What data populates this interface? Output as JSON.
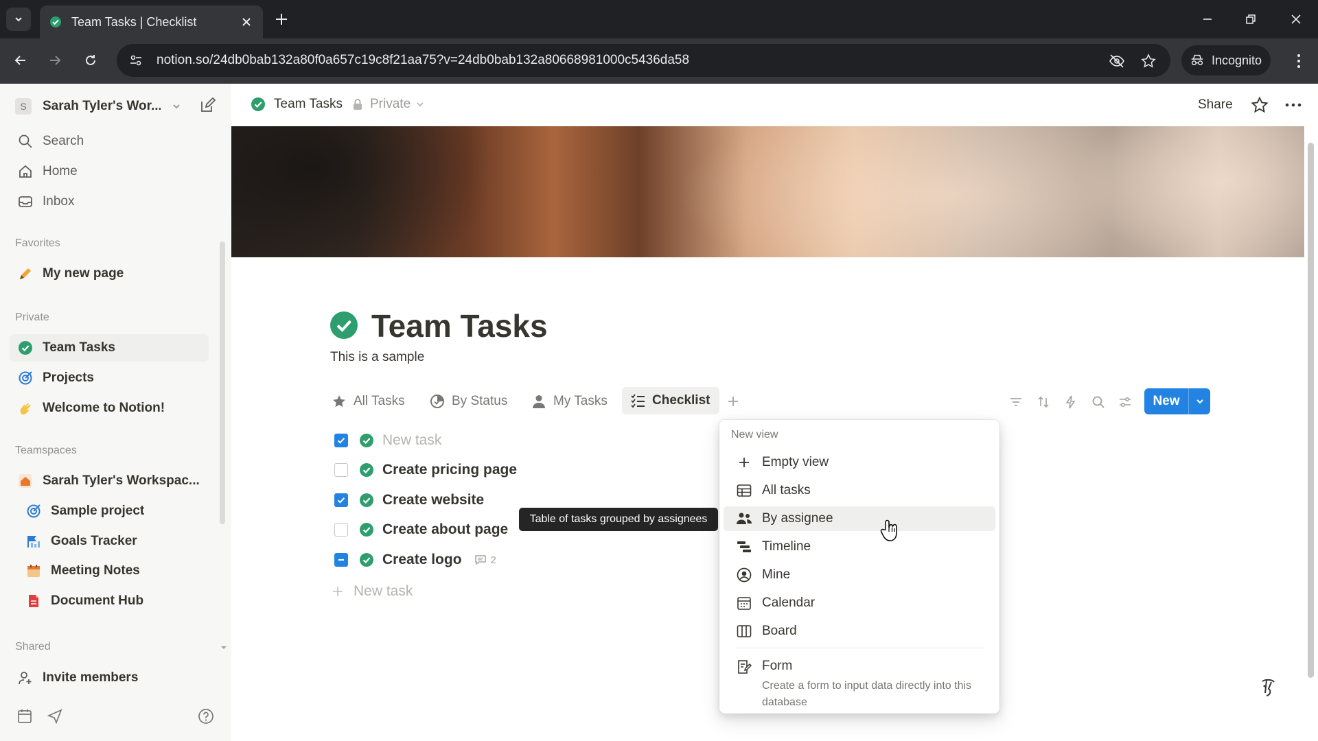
{
  "browser": {
    "tab_title": "Team Tasks | Checklist",
    "url": "notion.so/24db0bab132a80f0a657c19c8f21aa75?v=24db0bab132a80668981000c5436da58",
    "incognito_label": "Incognito"
  },
  "sidebar": {
    "workspace_initial": "S",
    "workspace_name": "Sarah Tyler's Wor...",
    "top_items": [
      {
        "label": "Search",
        "icon": "search-icon"
      },
      {
        "label": "Home",
        "icon": "home-icon"
      },
      {
        "label": "Inbox",
        "icon": "inbox-icon"
      }
    ],
    "favorites_label": "Favorites",
    "favorites": [
      {
        "label": "My new page",
        "icon": "pencil-icon"
      }
    ],
    "private_label": "Private",
    "private_items": [
      {
        "label": "Team Tasks",
        "icon": "check-circle-icon"
      },
      {
        "label": "Projects",
        "icon": "target-icon"
      },
      {
        "label": "Welcome to Notion!",
        "icon": "wave-icon"
      }
    ],
    "teamspaces_label": "Teamspaces",
    "teamspace_name": "Sarah Tyler's Workspac...",
    "teamspace_items": [
      {
        "label": "Sample project",
        "icon": "target-icon"
      },
      {
        "label": "Goals Tracker",
        "icon": "goals-icon"
      },
      {
        "label": "Meeting Notes",
        "icon": "calendar-icon"
      },
      {
        "label": "Document Hub",
        "icon": "document-icon"
      }
    ],
    "shared_label": "Shared",
    "invite_label": "Invite members"
  },
  "topbar": {
    "breadcrumb": "Team Tasks",
    "privacy": "Private",
    "share_label": "Share"
  },
  "page": {
    "title": "Team Tasks",
    "description": "This is a sample",
    "views": [
      {
        "label": "All Tasks",
        "icon": "star-icon"
      },
      {
        "label": "By Status",
        "icon": "status-icon"
      },
      {
        "label": "My Tasks",
        "icon": "person-icon"
      },
      {
        "label": "Checklist",
        "icon": "checklist-icon",
        "active": true
      }
    ],
    "new_button": "New",
    "tasks": [
      {
        "name": "New task",
        "checked": true,
        "placeholder": true
      },
      {
        "name": "Create pricing page",
        "checked": false
      },
      {
        "name": "Create website",
        "checked": true
      },
      {
        "name": "Create about page",
        "checked": false
      },
      {
        "name": "Create logo",
        "checked": true,
        "comments": "2"
      }
    ],
    "add_task_label": "New task",
    "tooltip": "Table of tasks grouped by assignees"
  },
  "menu": {
    "heading": "New view",
    "items": [
      {
        "label": "Empty view",
        "icon": "plus-icon"
      },
      {
        "label": "All tasks",
        "icon": "table-icon"
      },
      {
        "label": "By assignee",
        "icon": "people-icon",
        "hovered": true
      },
      {
        "label": "Timeline",
        "icon": "timeline-icon"
      },
      {
        "label": "Mine",
        "icon": "person-circle-icon"
      },
      {
        "label": "Calendar",
        "icon": "calendar-icon"
      },
      {
        "label": "Board",
        "icon": "board-icon"
      }
    ],
    "form_title": "Form",
    "form_description": "Create a form to input data directly into this database"
  },
  "colors": {
    "accent": "#2383e2",
    "status_green": "#2f9e6e",
    "sidebar_bg": "#f7f7f5",
    "chrome_dark": "#202124"
  }
}
